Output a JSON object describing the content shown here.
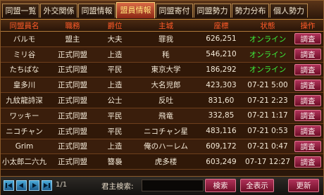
{
  "tabs": [
    {
      "label": "同盟一覧",
      "active": false
    },
    {
      "label": "外交関係",
      "active": false
    },
    {
      "label": "同盟情報",
      "active": false
    },
    {
      "label": "盟員情報",
      "active": true
    },
    {
      "label": "同盟寄付",
      "active": false
    },
    {
      "label": "同盟勢力",
      "active": false
    },
    {
      "label": "勢力分布",
      "active": false
    },
    {
      "label": "個人勢力",
      "active": false
    }
  ],
  "table": {
    "headers": {
      "name": "同盟員名",
      "role": "職務",
      "rank": "爵位",
      "city": "主城",
      "coord": "座標",
      "status": "状態",
      "action": "操作"
    },
    "rows": [
      {
        "name": "バルモ",
        "role": "盟主",
        "rank": "大夫",
        "city": "罪我",
        "coord": "626,251",
        "status": "オンライン",
        "online": true,
        "action": "調査"
      },
      {
        "name": "ミリ谷",
        "role": "正式同盟",
        "rank": "上造",
        "city": "秏",
        "coord": "546,210",
        "status": "オンライン",
        "online": true,
        "action": "調査"
      },
      {
        "name": "たちばな",
        "role": "正式同盟",
        "rank": "平民",
        "city": "東京大学",
        "coord": "186,292",
        "status": "オンライン",
        "online": true,
        "action": "調査"
      },
      {
        "name": "皇多川",
        "role": "正式同盟",
        "rank": "上造",
        "city": "大名児郎",
        "coord": "423,303",
        "status": "07-21  5:00",
        "online": false,
        "action": "調査"
      },
      {
        "name": "九紋龍詩深",
        "role": "正式同盟",
        "rank": "公士",
        "city": "反吐",
        "coord": "831,60",
        "status": "07-21  2:23",
        "online": false,
        "action": "調査"
      },
      {
        "name": "ワッキー",
        "role": "正式同盟",
        "rank": "平民",
        "city": "飛竜",
        "coord": "332,85",
        "status": "07-21  1:17",
        "online": false,
        "action": "調査"
      },
      {
        "name": "ニコチャン",
        "role": "正式同盟",
        "rank": "平民",
        "city": "ニコチャン星",
        "coord": "483,116",
        "status": "07-21  0:53",
        "online": false,
        "action": "調査"
      },
      {
        "name": "Grim",
        "role": "正式同盟",
        "rank": "上造",
        "city": "俺のハーレム",
        "coord": "609,172",
        "status": "07-21  0:47",
        "online": false,
        "action": "調査"
      },
      {
        "name": "小太郎二六九",
        "role": "正式同盟",
        "rank": "簪裊",
        "city": "虎多楼",
        "coord": "603,249",
        "status": "07-17  12:27",
        "online": false,
        "action": "調査"
      }
    ]
  },
  "footer": {
    "page": "1/1",
    "search_label": "君主検索:",
    "search_value": "",
    "search_button": "検索",
    "show_all_button": "全表示",
    "refresh_button": "更新"
  },
  "colors": {
    "header_text": "#ff5a28",
    "online_text": "#3cf43c",
    "button": "#8a1a3a",
    "nav_button": "#3a8ac0"
  },
  "icons": [
    "first-page-icon",
    "prev-page-icon",
    "next-page-icon",
    "last-page-icon"
  ]
}
